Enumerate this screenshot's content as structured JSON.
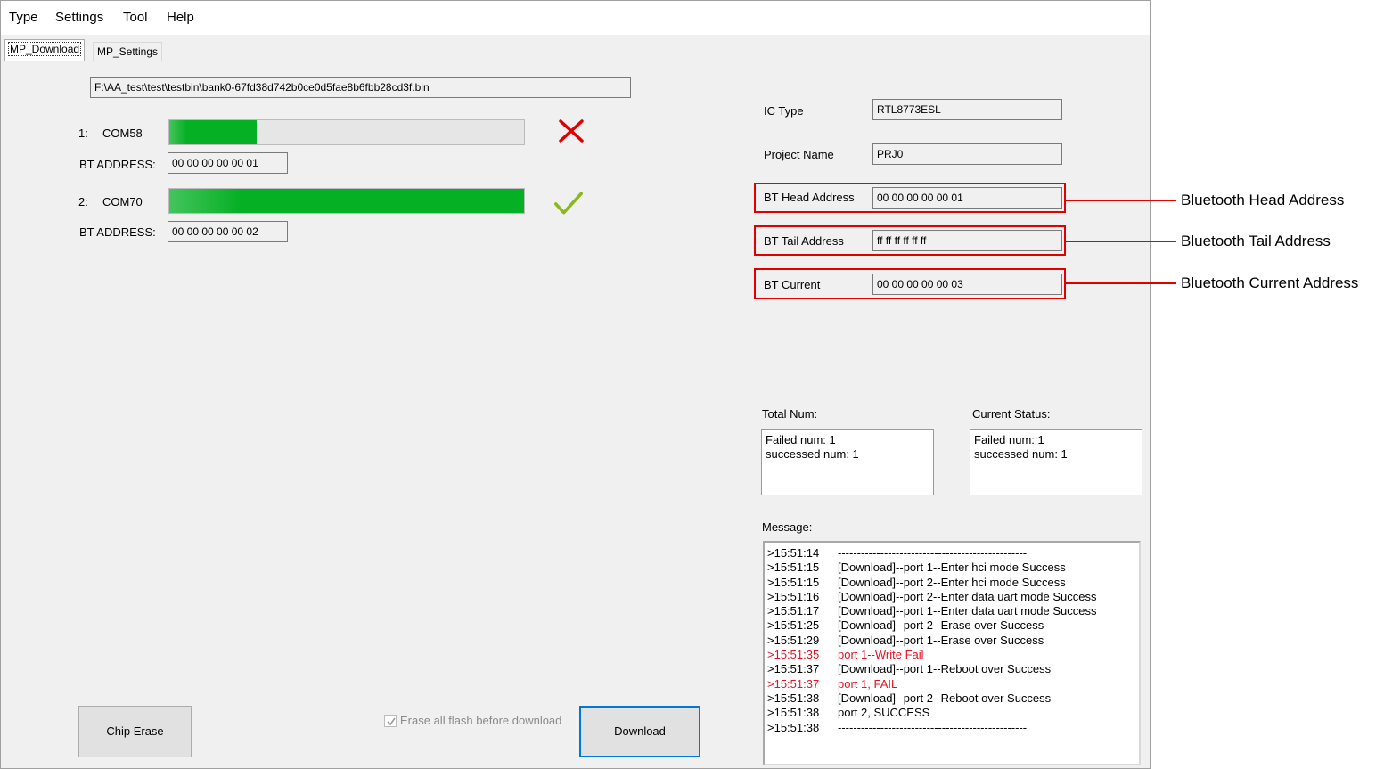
{
  "menu": [
    "Type",
    "Settings",
    "Tool",
    "Help"
  ],
  "tabs": [
    {
      "label": "MP_Download",
      "active": true
    },
    {
      "label": "MP_Settings",
      "active": false
    }
  ],
  "file_path": "F:\\AA_test\\test\\testbin\\bank0-67fd38d742b0ce0d5fae8b6fbb28cd3f.bin",
  "ports": [
    {
      "index": "1:",
      "com": "COM58",
      "bt_address_label": "BT ADDRESS:",
      "bt_address": "00 00 00 00 00 01",
      "progress": 0.245,
      "status": "fail",
      "status_icon": "red-x-icon"
    },
    {
      "index": "2:",
      "com": "COM70",
      "bt_address_label": "BT ADDRESS:",
      "bt_address": "00 00 00 00 00 02",
      "progress": 1.0,
      "status": "success",
      "status_icon": "green-check-icon"
    }
  ],
  "config": {
    "ic_type_label": "IC Type",
    "ic_type": "RTL8773ESL",
    "project_name_label": "Project Name",
    "project_name": "PRJ0",
    "bt_head_label": "BT Head Address",
    "bt_head": "00 00 00 00 00 01",
    "bt_tail_label": "BT Tail Address",
    "bt_tail": "ff ff ff ff ff ff",
    "bt_current_label": "BT Current",
    "bt_current": "00 00 00 00 00 03"
  },
  "totals": {
    "total_label": "Total Num:",
    "total_failed": "Failed num: 1",
    "total_success": "successed num: 1",
    "current_label": "Current Status:",
    "current_failed": "Failed num: 1",
    "current_success": "successed num: 1"
  },
  "message_label": "Message:",
  "messages": [
    {
      "time": ">15:51:14",
      "text": "-------------------------------------------------",
      "error": false
    },
    {
      "time": ">15:51:15",
      "text": "[Download]--port 1--Enter hci mode Success",
      "error": false
    },
    {
      "time": ">15:51:15",
      "text": "[Download]--port 2--Enter hci mode Success",
      "error": false
    },
    {
      "time": ">15:51:16",
      "text": "[Download]--port 2--Enter data uart mode Success",
      "error": false
    },
    {
      "time": ">15:51:17",
      "text": "[Download]--port 1--Enter data uart mode Success",
      "error": false
    },
    {
      "time": ">15:51:25",
      "text": "[Download]--port 2--Erase over Success",
      "error": false
    },
    {
      "time": ">15:51:29",
      "text": "[Download]--port 1--Erase over Success",
      "error": false
    },
    {
      "time": ">15:51:35",
      "text": "port 1--Write Fail",
      "error": true
    },
    {
      "time": ">15:51:37",
      "text": "[Download]--port 1--Reboot over Success",
      "error": false
    },
    {
      "time": ">15:51:37",
      "text": "port 1, FAIL",
      "error": true
    },
    {
      "time": ">15:51:38",
      "text": "[Download]--port 2--Reboot over Success",
      "error": false
    },
    {
      "time": ">15:51:38",
      "text": "port 2, SUCCESS",
      "error": false
    },
    {
      "time": ">15:51:38",
      "text": "-------------------------------------------------",
      "error": false
    }
  ],
  "buttons": {
    "chip_erase": "Chip Erase",
    "erase_all_checkbox": "Erase all flash before download",
    "erase_all_checked": true,
    "download": "Download"
  },
  "annotations": {
    "head": "Bluetooth Head Address",
    "tail": "Bluetooth Tail Address",
    "current": "Bluetooth Current Address"
  },
  "colors": {
    "progress_green": "#06b025",
    "annotation_red": "#e00000",
    "error_text": "#e81123",
    "default_button_border": "#0078d7"
  }
}
